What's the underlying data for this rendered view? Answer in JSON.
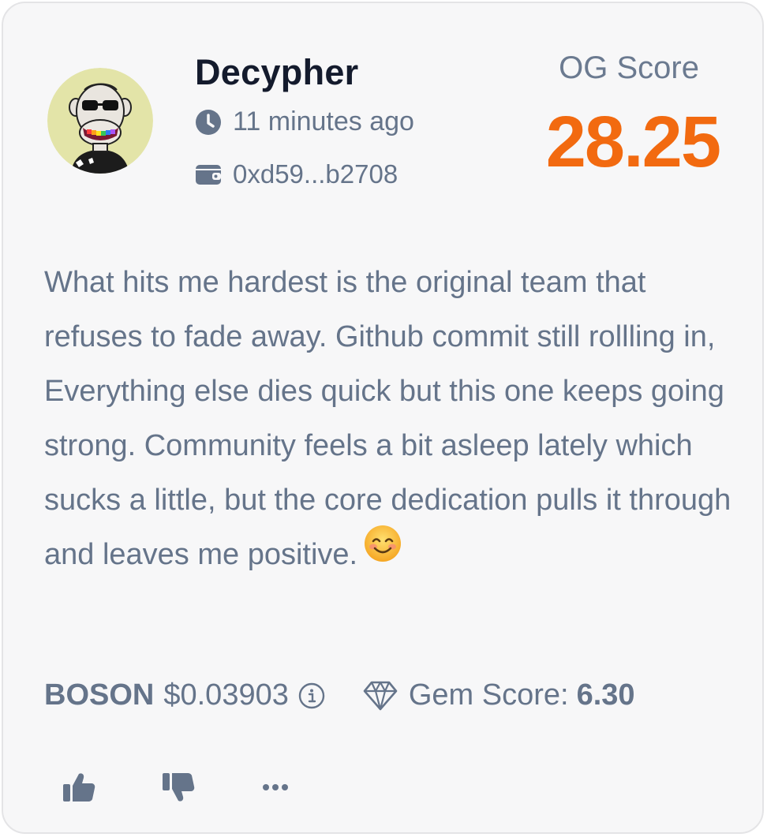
{
  "user": {
    "name": "Decypher",
    "time_ago": "11 minutes ago",
    "wallet": "0xd59...b2708"
  },
  "og_score": {
    "label": "OG Score",
    "value": "28.25",
    "color": "#f26a10"
  },
  "post": {
    "text": "What hits me hardest is the original team that refuses to fade away. Github commit still rollling in, Everything else dies quick but this one keeps going strong. Community feels a bit asleep lately which sucks a little, but the core dedication pulls it through and leaves me positive.",
    "emoji": "smiling-face-emoji"
  },
  "token": {
    "symbol": "BOSON",
    "price": "$0.03903",
    "gem_label": "Gem Score:",
    "gem_value": "6.30"
  },
  "icons": {
    "time": "clock-icon",
    "wallet": "wallet-icon",
    "info": "info-icon",
    "gem": "gem-icon",
    "like": "thumbs-up-icon",
    "dislike": "thumbs-down-icon",
    "more": "more-icon"
  },
  "colors": {
    "text_muted": "#65748a",
    "text_dark": "#141b2d",
    "accent": "#f26a10",
    "card_bg": "#f7f7f8"
  }
}
